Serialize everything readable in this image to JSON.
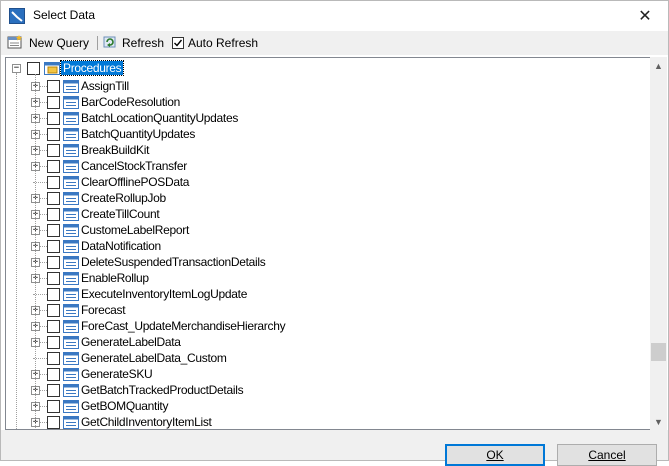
{
  "window": {
    "title": "Select Data"
  },
  "toolbar": {
    "new_query_label": "New Query",
    "refresh_label": "Refresh",
    "auto_refresh_label": "Auto Refresh",
    "auto_refresh_checked": true
  },
  "tree": {
    "root": {
      "label": "Procedures",
      "expanded": true,
      "checked": false
    },
    "items": [
      {
        "label": "AssignTill",
        "expandable": true
      },
      {
        "label": "BarCodeResolution",
        "expandable": true
      },
      {
        "label": "BatchLocationQuantityUpdates",
        "expandable": true
      },
      {
        "label": "BatchQuantityUpdates",
        "expandable": true
      },
      {
        "label": "BreakBuildKit",
        "expandable": true
      },
      {
        "label": "CancelStockTransfer",
        "expandable": true
      },
      {
        "label": "ClearOfflinePOSData",
        "expandable": false
      },
      {
        "label": "CreateRollupJob",
        "expandable": true
      },
      {
        "label": "CreateTillCount",
        "expandable": true
      },
      {
        "label": "CustomeLabelReport",
        "expandable": true
      },
      {
        "label": "DataNotification",
        "expandable": true
      },
      {
        "label": "DeleteSuspendedTransactionDetails",
        "expandable": true
      },
      {
        "label": "EnableRollup",
        "expandable": true
      },
      {
        "label": "ExecuteInventoryItemLogUpdate",
        "expandable": false
      },
      {
        "label": "Forecast",
        "expandable": true
      },
      {
        "label": "ForeCast_UpdateMerchandiseHierarchy",
        "expandable": true
      },
      {
        "label": "GenerateLabelData",
        "expandable": true
      },
      {
        "label": "GenerateLabelData_Custom",
        "expandable": false
      },
      {
        "label": "GenerateSKU",
        "expandable": true
      },
      {
        "label": "GetBatchTrackedProductDetails",
        "expandable": true
      },
      {
        "label": "GetBOMQuantity",
        "expandable": true
      },
      {
        "label": "GetChildInventoryItemList",
        "expandable": true
      }
    ]
  },
  "buttons": {
    "ok_label": "OK",
    "cancel_label": "Cancel"
  },
  "colors": {
    "selection": "#0078d7",
    "toolbar_bg": "#f0f0f0"
  }
}
